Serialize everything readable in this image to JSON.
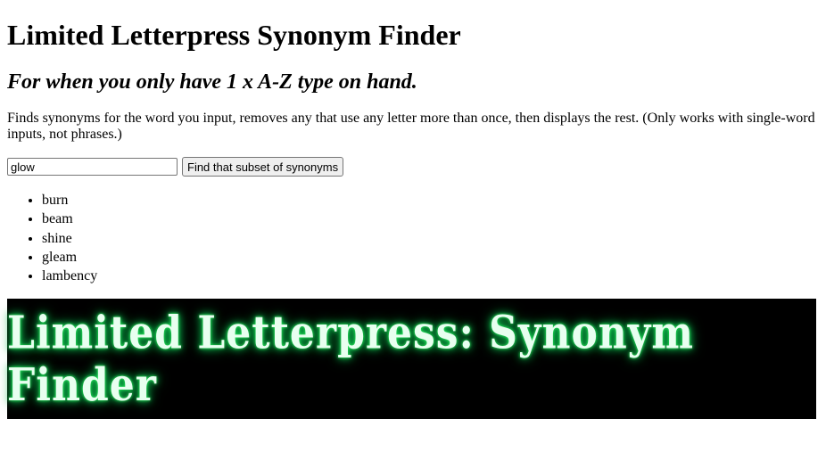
{
  "header": {
    "title": "Limited Letterpress Synonym Finder",
    "subtitle": "For when you only have 1 x A-Z type on hand."
  },
  "description": "Finds synonyms for the word you input, removes any that use any letter more than once, then displays the rest. (Only works with single-word inputs, not phrases.)",
  "form": {
    "input_value": "glow",
    "button_label": "Find that subset of synonyms"
  },
  "results": [
    "burn",
    "beam",
    "shine",
    "gleam",
    "lambency"
  ],
  "banner": {
    "text": "Limited Letterpress: Synonym Finder",
    "glow_color": "#22dd66"
  }
}
